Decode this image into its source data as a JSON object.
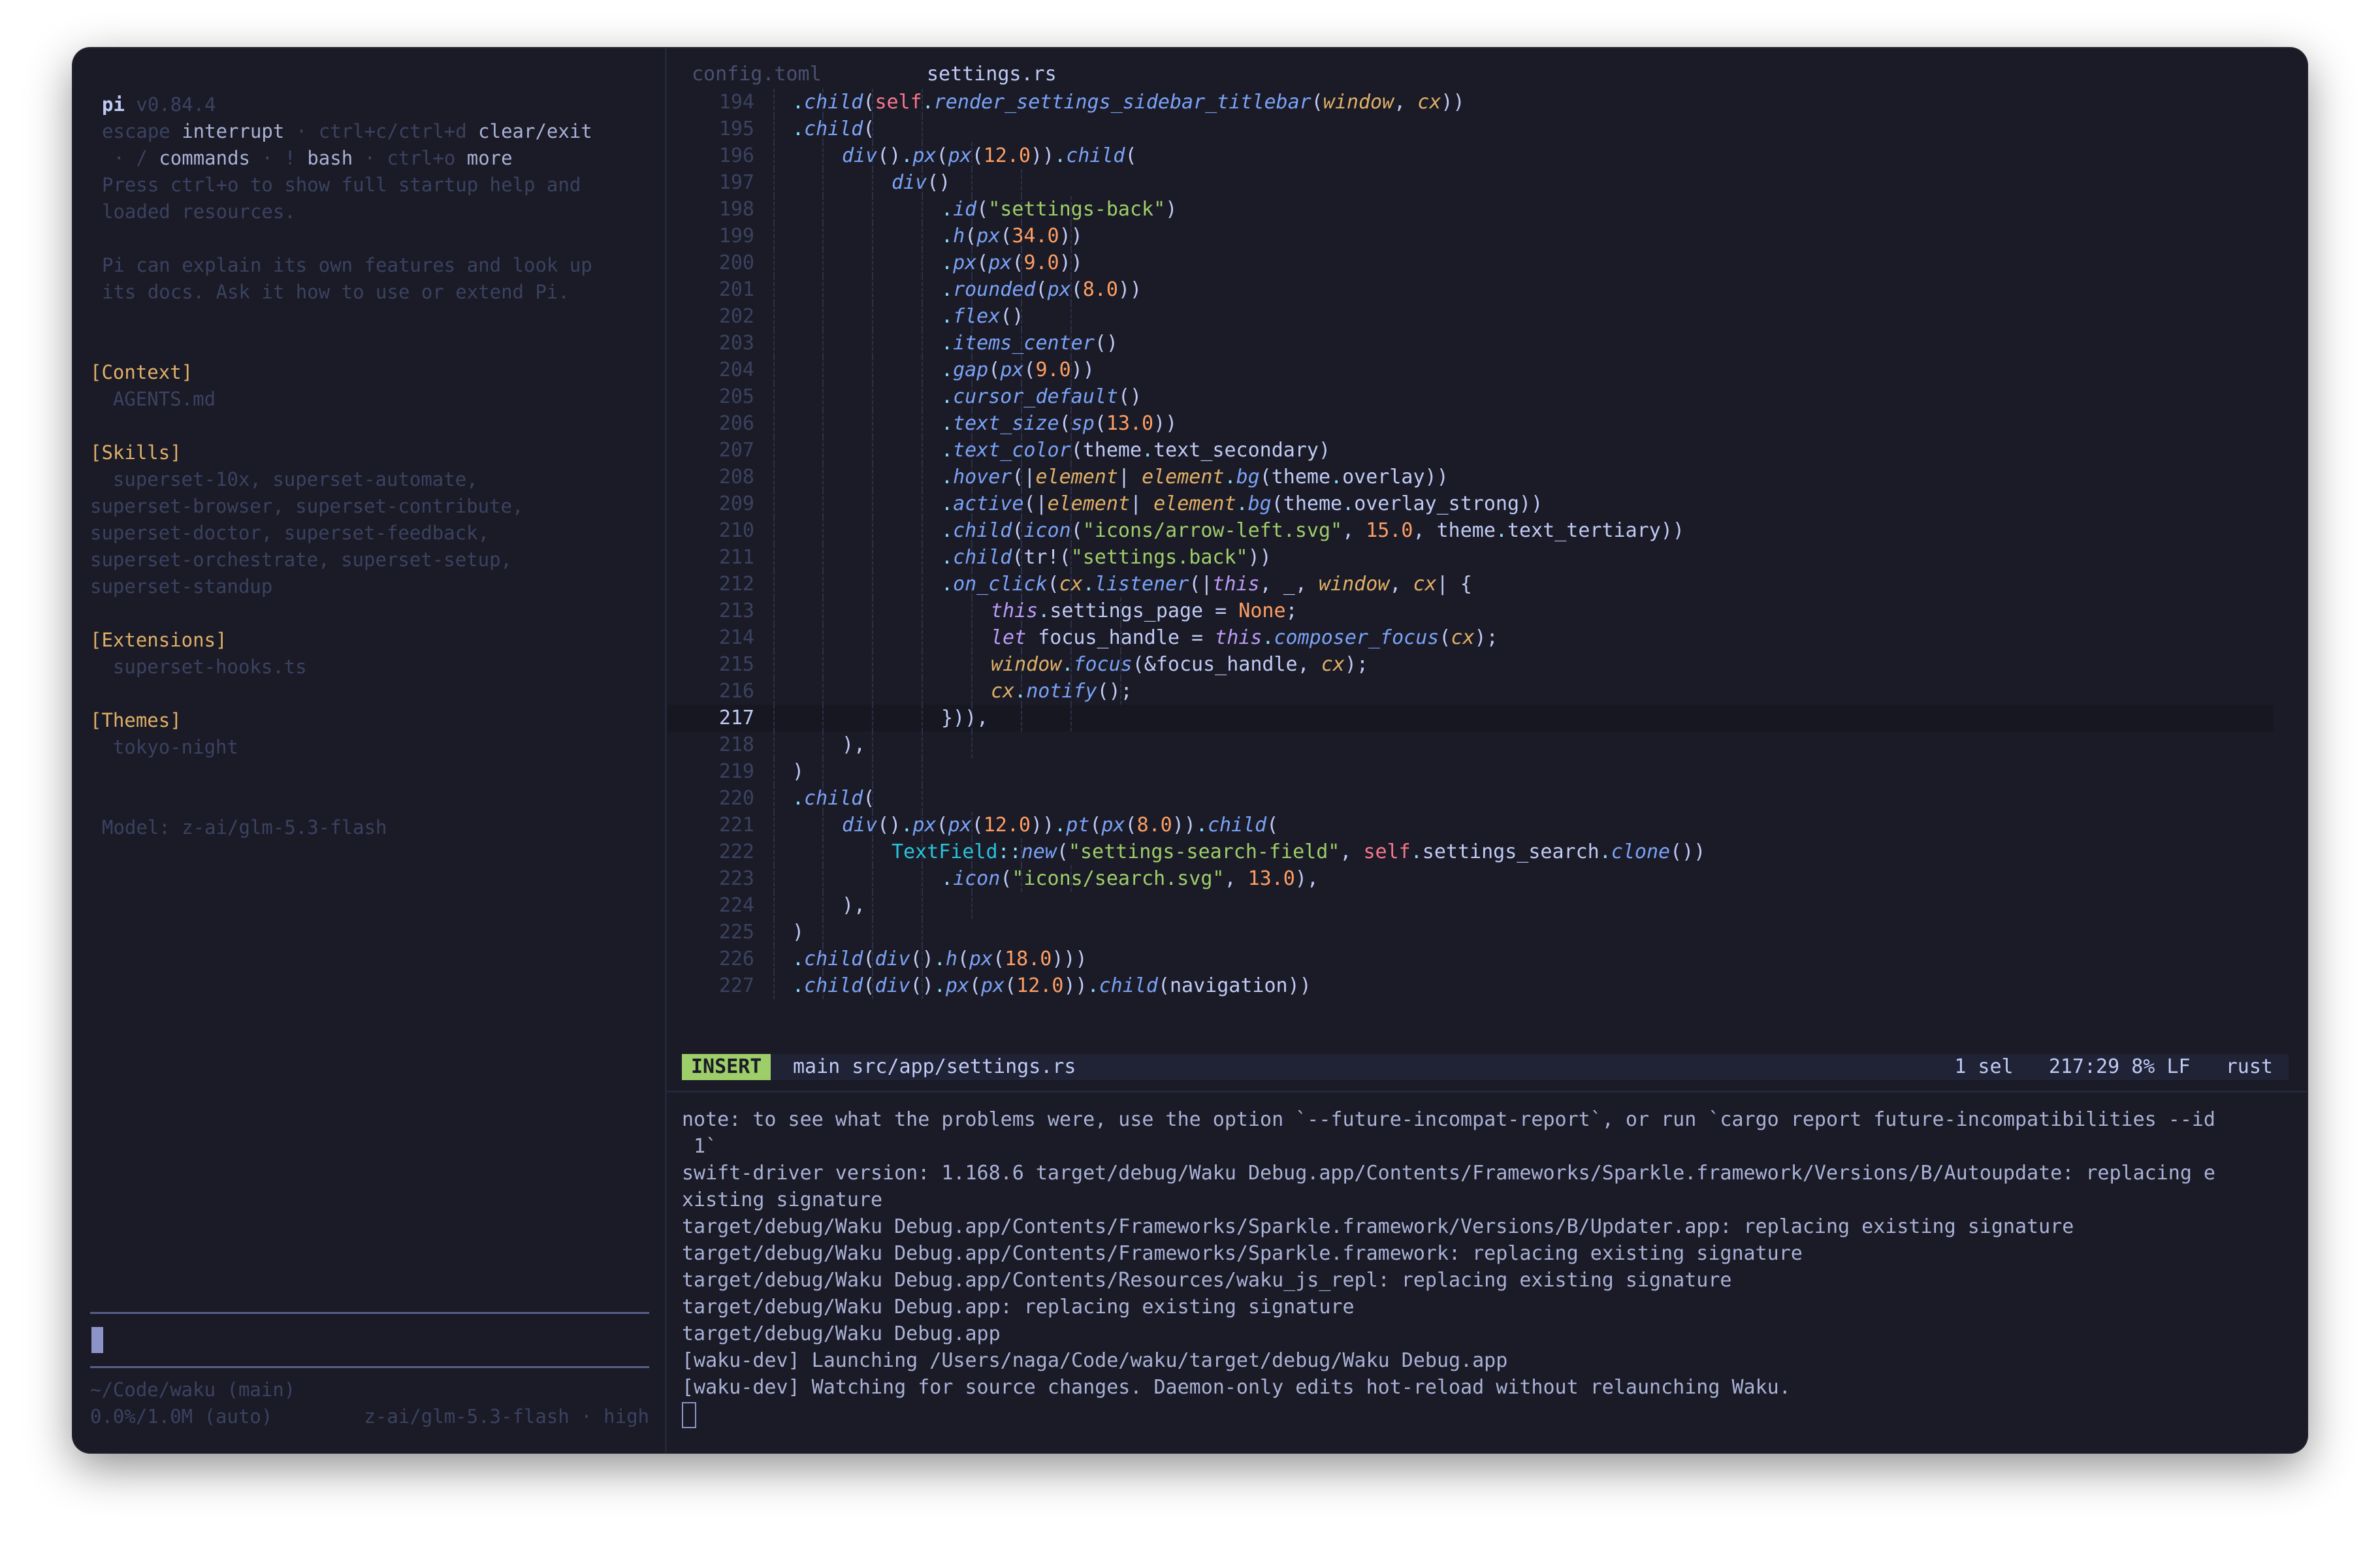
{
  "sidebar": {
    "app_name": "pi",
    "version": "v0.84.4",
    "help1": [
      "escape ",
      "interrupt",
      " · ctrl+c/ctrl+d ",
      "clear/exit"
    ],
    "help2": [
      " · / ",
      "commands",
      " · ! ",
      "bash",
      " · ctrl+o ",
      "more"
    ],
    "startup_help_1": "Press ctrl+o to show full startup help and",
    "startup_help_2": "loaded resources.",
    "pi_explain_1": "Pi can explain its own features and look up",
    "pi_explain_2": "its docs. Ask it how to use or extend Pi.",
    "sections": [
      {
        "heading": "[Context]",
        "lines": [
          "  AGENTS.md"
        ]
      },
      {
        "heading": "[Skills]",
        "lines": [
          "  superset-10x, superset-automate,",
          "superset-browser, superset-contribute,",
          "superset-doctor, superset-feedback,",
          "superset-orchestrate, superset-setup,",
          "superset-standup"
        ]
      },
      {
        "heading": "[Extensions]",
        "lines": [
          "  superset-hooks.ts"
        ]
      },
      {
        "heading": "[Themes]",
        "lines": [
          "  tokyo-night"
        ]
      }
    ],
    "model_line": "Model: z-ai/glm-5.3-flash",
    "cwd": "~/Code/waku (main)",
    "usage": "0.0%/1.0M (auto)",
    "model_status": "z-ai/glm-5.3-flash · high"
  },
  "editor": {
    "tabs": [
      "config.toml",
      "settings.rs"
    ],
    "active_tab": 1,
    "current_line": 217,
    "lines": [
      {
        "n": "194",
        "g": 4,
        "t": [
          [
            "d",
            "."
          ],
          [
            "m",
            "child"
          ],
          [
            "p",
            "("
          ],
          [
            "self",
            "self"
          ],
          [
            "d",
            "."
          ],
          [
            "m",
            "render_settings_sidebar_titlebar"
          ],
          [
            "p",
            "("
          ],
          [
            "v",
            "window"
          ],
          [
            "p",
            ", "
          ],
          [
            "v",
            "cx"
          ],
          [
            "p",
            "))"
          ]
        ]
      },
      {
        "n": "195",
        "g": 4,
        "t": [
          [
            "d",
            "."
          ],
          [
            "m",
            "child"
          ],
          [
            "p",
            "("
          ]
        ]
      },
      {
        "n": "196",
        "g": 5,
        "t": [
          [
            "m",
            "div"
          ],
          [
            "p",
            "()"
          ],
          [
            "d",
            "."
          ],
          [
            "m",
            "px"
          ],
          [
            "p",
            "("
          ],
          [
            "m",
            "px"
          ],
          [
            "p",
            "("
          ],
          [
            "n",
            "12.0"
          ],
          [
            "p",
            "))"
          ],
          [
            "d",
            "."
          ],
          [
            "m",
            "child"
          ],
          [
            "p",
            "("
          ]
        ]
      },
      {
        "n": "197",
        "g": 6,
        "t": [
          [
            "m",
            "div"
          ],
          [
            "p",
            "()"
          ]
        ]
      },
      {
        "n": "198",
        "g": 7,
        "t": [
          [
            "d",
            "."
          ],
          [
            "m",
            "id"
          ],
          [
            "p",
            "("
          ],
          [
            "s",
            "\"settings-back\""
          ],
          [
            "p",
            ")"
          ]
        ]
      },
      {
        "n": "199",
        "g": 7,
        "t": [
          [
            "d",
            "."
          ],
          [
            "m",
            "h"
          ],
          [
            "p",
            "("
          ],
          [
            "m",
            "px"
          ],
          [
            "p",
            "("
          ],
          [
            "n",
            "34.0"
          ],
          [
            "p",
            "))"
          ]
        ]
      },
      {
        "n": "200",
        "g": 7,
        "t": [
          [
            "d",
            "."
          ],
          [
            "m",
            "px"
          ],
          [
            "p",
            "("
          ],
          [
            "m",
            "px"
          ],
          [
            "p",
            "("
          ],
          [
            "n",
            "9.0"
          ],
          [
            "p",
            "))"
          ]
        ]
      },
      {
        "n": "201",
        "g": 7,
        "t": [
          [
            "d",
            "."
          ],
          [
            "m",
            "rounded"
          ],
          [
            "p",
            "("
          ],
          [
            "m",
            "px"
          ],
          [
            "p",
            "("
          ],
          [
            "n",
            "8.0"
          ],
          [
            "p",
            "))"
          ]
        ]
      },
      {
        "n": "202",
        "g": 7,
        "t": [
          [
            "d",
            "."
          ],
          [
            "m",
            "flex"
          ],
          [
            "p",
            "()"
          ]
        ]
      },
      {
        "n": "203",
        "g": 7,
        "t": [
          [
            "d",
            "."
          ],
          [
            "m",
            "items_center"
          ],
          [
            "p",
            "()"
          ]
        ]
      },
      {
        "n": "204",
        "g": 7,
        "t": [
          [
            "d",
            "."
          ],
          [
            "m",
            "gap"
          ],
          [
            "p",
            "("
          ],
          [
            "m",
            "px"
          ],
          [
            "p",
            "("
          ],
          [
            "n",
            "9.0"
          ],
          [
            "p",
            "))"
          ]
        ]
      },
      {
        "n": "205",
        "g": 7,
        "t": [
          [
            "d",
            "."
          ],
          [
            "m",
            "cursor_default"
          ],
          [
            "p",
            "()"
          ]
        ]
      },
      {
        "n": "206",
        "g": 7,
        "t": [
          [
            "d",
            "."
          ],
          [
            "m",
            "text_size"
          ],
          [
            "p",
            "("
          ],
          [
            "m",
            "sp"
          ],
          [
            "p",
            "("
          ],
          [
            "n",
            "13.0"
          ],
          [
            "p",
            "))"
          ]
        ]
      },
      {
        "n": "207",
        "g": 7,
        "t": [
          [
            "d",
            "."
          ],
          [
            "m",
            "text_color"
          ],
          [
            "p",
            "(theme"
          ],
          [
            "d",
            "."
          ],
          [
            "p",
            "text_secondary)"
          ]
        ]
      },
      {
        "n": "208",
        "g": 7,
        "t": [
          [
            "d",
            "."
          ],
          [
            "m",
            "hover"
          ],
          [
            "p",
            "(|"
          ],
          [
            "v",
            "element"
          ],
          [
            "p",
            "| "
          ],
          [
            "v",
            "element"
          ],
          [
            "d",
            "."
          ],
          [
            "m",
            "bg"
          ],
          [
            "p",
            "(theme"
          ],
          [
            "d",
            "."
          ],
          [
            "p",
            "overlay))"
          ]
        ]
      },
      {
        "n": "209",
        "g": 7,
        "t": [
          [
            "d",
            "."
          ],
          [
            "m",
            "active"
          ],
          [
            "p",
            "(|"
          ],
          [
            "v",
            "element"
          ],
          [
            "p",
            "| "
          ],
          [
            "v",
            "element"
          ],
          [
            "d",
            "."
          ],
          [
            "m",
            "bg"
          ],
          [
            "p",
            "(theme"
          ],
          [
            "d",
            "."
          ],
          [
            "p",
            "overlay_strong))"
          ]
        ]
      },
      {
        "n": "210",
        "g": 7,
        "t": [
          [
            "d",
            "."
          ],
          [
            "m",
            "child"
          ],
          [
            "p",
            "("
          ],
          [
            "m",
            "icon"
          ],
          [
            "p",
            "("
          ],
          [
            "s",
            "\"icons/arrow-left.svg\""
          ],
          [
            "p",
            ", "
          ],
          [
            "n",
            "15.0"
          ],
          [
            "p",
            ", theme"
          ],
          [
            "d",
            "."
          ],
          [
            "p",
            "text_tertiary))"
          ]
        ]
      },
      {
        "n": "211",
        "g": 7,
        "t": [
          [
            "d",
            "."
          ],
          [
            "m",
            "child"
          ],
          [
            "p",
            "(tr!("
          ],
          [
            "s",
            "\"settings.back\""
          ],
          [
            "p",
            "))"
          ]
        ]
      },
      {
        "n": "212",
        "g": 7,
        "t": [
          [
            "d",
            "."
          ],
          [
            "m",
            "on_click"
          ],
          [
            "p",
            "("
          ],
          [
            "v",
            "cx"
          ],
          [
            "d",
            "."
          ],
          [
            "m",
            "listener"
          ],
          [
            "p",
            "(|"
          ],
          [
            "k",
            "this"
          ],
          [
            "p",
            ", _, "
          ],
          [
            "v",
            "window"
          ],
          [
            "p",
            ", "
          ],
          [
            "v",
            "cx"
          ],
          [
            "p",
            "| {"
          ]
        ]
      },
      {
        "n": "213",
        "g": 8,
        "t": [
          [
            "k",
            "this"
          ],
          [
            "d",
            "."
          ],
          [
            "p",
            "settings_page = "
          ],
          [
            "n",
            "None"
          ],
          [
            "p",
            ";"
          ]
        ]
      },
      {
        "n": "214",
        "g": 8,
        "t": [
          [
            "k",
            "let"
          ],
          [
            "p",
            " focus_handle = "
          ],
          [
            "k",
            "this"
          ],
          [
            "d",
            "."
          ],
          [
            "m",
            "composer_focus"
          ],
          [
            "p",
            "("
          ],
          [
            "v",
            "cx"
          ],
          [
            "p",
            ");"
          ]
        ]
      },
      {
        "n": "215",
        "g": 8,
        "t": [
          [
            "v",
            "window"
          ],
          [
            "d",
            "."
          ],
          [
            "m",
            "focus"
          ],
          [
            "p",
            "(&focus_handle, "
          ],
          [
            "v",
            "cx"
          ],
          [
            "p",
            ");"
          ]
        ]
      },
      {
        "n": "216",
        "g": 8,
        "t": [
          [
            "v",
            "cx"
          ],
          [
            "d",
            "."
          ],
          [
            "m",
            "notify"
          ],
          [
            "p",
            "();"
          ]
        ]
      },
      {
        "n": "217",
        "g": 7,
        "t": [
          [
            "p",
            "})),"
          ]
        ]
      },
      {
        "n": "218",
        "g": 5,
        "t": [
          [
            "p",
            "),"
          ]
        ]
      },
      {
        "n": "219",
        "g": 4,
        "t": [
          [
            "p",
            ")"
          ]
        ]
      },
      {
        "n": "220",
        "g": 4,
        "t": [
          [
            "d",
            "."
          ],
          [
            "m",
            "child"
          ],
          [
            "p",
            "("
          ]
        ]
      },
      {
        "n": "221",
        "g": 5,
        "t": [
          [
            "m",
            "div"
          ],
          [
            "p",
            "()"
          ],
          [
            "d",
            "."
          ],
          [
            "m",
            "px"
          ],
          [
            "p",
            "("
          ],
          [
            "m",
            "px"
          ],
          [
            "p",
            "("
          ],
          [
            "n",
            "12.0"
          ],
          [
            "p",
            "))"
          ],
          [
            "d",
            "."
          ],
          [
            "m",
            "pt"
          ],
          [
            "p",
            "("
          ],
          [
            "m",
            "px"
          ],
          [
            "p",
            "("
          ],
          [
            "n",
            "8.0"
          ],
          [
            "p",
            "))"
          ],
          [
            "d",
            "."
          ],
          [
            "m",
            "child"
          ],
          [
            "p",
            "("
          ]
        ]
      },
      {
        "n": "222",
        "g": 6,
        "t": [
          [
            "ty",
            "TextField"
          ],
          [
            "d",
            "::"
          ],
          [
            "m",
            "new"
          ],
          [
            "p",
            "("
          ],
          [
            "s",
            "\"settings-search-field\""
          ],
          [
            "p",
            ", "
          ],
          [
            "self",
            "self"
          ],
          [
            "d",
            "."
          ],
          [
            "p",
            "settings_search"
          ],
          [
            "d",
            "."
          ],
          [
            "m",
            "clone"
          ],
          [
            "p",
            "())"
          ]
        ]
      },
      {
        "n": "223",
        "g": 7,
        "t": [
          [
            "d",
            "."
          ],
          [
            "m",
            "icon"
          ],
          [
            "p",
            "("
          ],
          [
            "s",
            "\"icons/search.svg\""
          ],
          [
            "p",
            ", "
          ],
          [
            "n",
            "13.0"
          ],
          [
            "p",
            "),"
          ]
        ]
      },
      {
        "n": "224",
        "g": 5,
        "t": [
          [
            "p",
            "),"
          ]
        ]
      },
      {
        "n": "225",
        "g": 4,
        "t": [
          [
            "p",
            ")"
          ]
        ]
      },
      {
        "n": "226",
        "g": 4,
        "t": [
          [
            "d",
            "."
          ],
          [
            "m",
            "child"
          ],
          [
            "p",
            "("
          ],
          [
            "m",
            "div"
          ],
          [
            "p",
            "()"
          ],
          [
            "d",
            "."
          ],
          [
            "m",
            "h"
          ],
          [
            "p",
            "("
          ],
          [
            "m",
            "px"
          ],
          [
            "p",
            "("
          ],
          [
            "n",
            "18.0"
          ],
          [
            "p",
            ")))"
          ]
        ]
      },
      {
        "n": "227",
        "g": 4,
        "t": [
          [
            "d",
            "."
          ],
          [
            "m",
            "child"
          ],
          [
            "p",
            "("
          ],
          [
            "m",
            "div"
          ],
          [
            "p",
            "()"
          ],
          [
            "d",
            "."
          ],
          [
            "m",
            "px"
          ],
          [
            "p",
            "("
          ],
          [
            "m",
            "px"
          ],
          [
            "p",
            "("
          ],
          [
            "n",
            "12.0"
          ],
          [
            "p",
            "))"
          ],
          [
            "d",
            "."
          ],
          [
            "m",
            "child"
          ],
          [
            "p",
            "(navigation))"
          ]
        ]
      }
    ]
  },
  "statusbar": {
    "mode": "INSERT",
    "branch_file": "main src/app/settings.rs",
    "selection": "1 sel",
    "position": "217:29",
    "percent": "8%",
    "line_ending": "LF",
    "language": "rust"
  },
  "terminal": {
    "lines": [
      "note: to see what the problems were, use the option `--future-incompat-report`, or run `cargo report future-incompatibilities --id",
      " 1`",
      "swift-driver version: 1.168.6 target/debug/Waku Debug.app/Contents/Frameworks/Sparkle.framework/Versions/B/Autoupdate: replacing e",
      "xisting signature",
      "target/debug/Waku Debug.app/Contents/Frameworks/Sparkle.framework/Versions/B/Updater.app: replacing existing signature",
      "target/debug/Waku Debug.app/Contents/Frameworks/Sparkle.framework: replacing existing signature",
      "target/debug/Waku Debug.app/Contents/Resources/waku_js_repl: replacing existing signature",
      "target/debug/Waku Debug.app: replacing existing signature",
      "target/debug/Waku Debug.app",
      "[waku-dev] Launching /Users/naga/Code/waku/target/debug/Waku Debug.app",
      "[waku-dev] Watching for source changes. Daemon-only edits hot-reload without relaunching Waku."
    ]
  },
  "colors": {
    "background": "#1a1b26",
    "accent_insert": "#9ece6a",
    "section_heading": "#e0af68",
    "dim_text": "#3b4261",
    "scrollbar": "#3b4261"
  }
}
